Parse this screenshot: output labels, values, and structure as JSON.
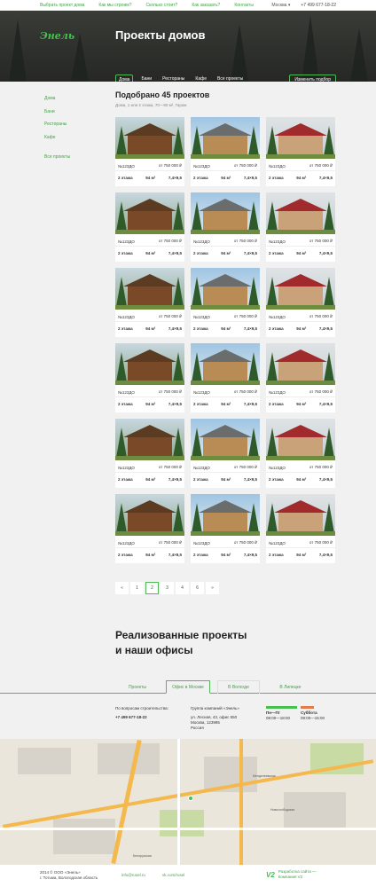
{
  "topbar": {
    "links": [
      "Выбрать проект дома",
      "Как мы строим?",
      "Сколько стоит?",
      "Как заказать?",
      "Контакты"
    ],
    "city": "Москва ▾",
    "phone": "+7 499 677-18-22"
  },
  "hero": {
    "logo": "Энель",
    "title": "Проекты домов",
    "tabs": [
      "Дома",
      "Бани",
      "Рестораны",
      "Кафе",
      "Все проекты"
    ],
    "filter_button": "Изменить подбор"
  },
  "sidebar": {
    "items": [
      "Дома",
      "Бани",
      "Рестораны",
      "Кафе"
    ],
    "all": "Все проекты"
  },
  "results": {
    "heading": "Подобрано 45 проектов",
    "filters": "Дома, 1 или 2 этажа, 70—90 м², Гараж"
  },
  "cards": [
    {
      "id": "№123ДО",
      "price": "от 750 000 ₽",
      "floors": "2 этажа",
      "area": "94 м²",
      "size": "7,4×9,5",
      "style": "wood"
    },
    {
      "id": "№123ДО",
      "price": "от 750 000 ₽",
      "floors": "2 этажа",
      "area": "94 м²",
      "size": "7,4×9,5",
      "style": "log"
    },
    {
      "id": "№123ДО",
      "price": "от 750 000 ₽",
      "floors": "2 этажа",
      "area": "94 м²",
      "size": "7,4×9,5",
      "style": "red"
    },
    {
      "id": "№123ДО",
      "price": "от 750 000 ₽",
      "floors": "2 этажа",
      "area": "94 м²",
      "size": "7,4×9,5",
      "style": "wood"
    },
    {
      "id": "№123ДО",
      "price": "от 750 000 ₽",
      "floors": "2 этажа",
      "area": "94 м²",
      "size": "7,4×9,5",
      "style": "log"
    },
    {
      "id": "№123ДО",
      "price": "от 750 000 ₽",
      "floors": "2 этажа",
      "area": "94 м²",
      "size": "7,4×9,5",
      "style": "red"
    },
    {
      "id": "№123ДО",
      "price": "от 750 000 ₽",
      "floors": "2 этажа",
      "area": "94 м²",
      "size": "7,4×9,5",
      "style": "wood"
    },
    {
      "id": "№123ДО",
      "price": "от 750 000 ₽",
      "floors": "2 этажа",
      "area": "94 м²",
      "size": "7,4×9,5",
      "style": "log"
    },
    {
      "id": "№123ДО",
      "price": "от 750 000 ₽",
      "floors": "2 этажа",
      "area": "94 м²",
      "size": "7,4×9,5",
      "style": "red"
    },
    {
      "id": "№123ДО",
      "price": "от 750 000 ₽",
      "floors": "2 этажа",
      "area": "94 м²",
      "size": "7,4×9,5",
      "style": "wood"
    },
    {
      "id": "№123ДО",
      "price": "от 750 000 ₽",
      "floors": "2 этажа",
      "area": "94 м²",
      "size": "7,4×9,5",
      "style": "log"
    },
    {
      "id": "№123ДО",
      "price": "от 750 000 ₽",
      "floors": "2 этажа",
      "area": "94 м²",
      "size": "7,4×9,5",
      "style": "red"
    },
    {
      "id": "№123ДО",
      "price": "от 750 000 ₽",
      "floors": "2 этажа",
      "area": "94 м²",
      "size": "7,4×9,5",
      "style": "wood"
    },
    {
      "id": "№123ДО",
      "price": "от 750 000 ₽",
      "floors": "2 этажа",
      "area": "94 м²",
      "size": "7,4×9,5",
      "style": "log"
    },
    {
      "id": "№123ДО",
      "price": "от 750 000 ₽",
      "floors": "2 этажа",
      "area": "94 м²",
      "size": "7,4×9,5",
      "style": "red"
    },
    {
      "id": "№123ДО",
      "price": "от 750 000 ₽",
      "floors": "2 этажа",
      "area": "94 м²",
      "size": "7,4×9,5",
      "style": "wood"
    },
    {
      "id": "№123ДО",
      "price": "от 750 000 ₽",
      "floors": "2 этажа",
      "area": "94 м²",
      "size": "7,4×9,5",
      "style": "log"
    },
    {
      "id": "№123ДО",
      "price": "от 750 000 ₽",
      "floors": "2 этажа",
      "area": "94 м²",
      "size": "7,4×9,5",
      "style": "red"
    }
  ],
  "pagination": {
    "prev": "«",
    "pages": [
      "1",
      "2",
      "3",
      "4",
      "6"
    ],
    "current": "2",
    "next": "»"
  },
  "realized": {
    "line1": "Реализованные проекты",
    "line2": "и наши офисы"
  },
  "office_tabs": {
    "projects": "Проекты",
    "moscow": "Офис в Москве",
    "vologda": "В Вологде",
    "lipetsk": "В Липецке"
  },
  "office": {
    "question": "По вопросам строительства:",
    "phone": "+7 499 677-18-22",
    "group": "Группа компаний «Энель»",
    "address1": "ул. Лесная, 43, офис 550",
    "address2": "Москва, 123995",
    "address3": "Россия",
    "weekdays_label": "Пн—Пт",
    "weekdays_hours": "08:00—18:00",
    "saturday_label": "Суббота",
    "saturday_hours": "09:00—15:00"
  },
  "map": {
    "labels": [
      "Менделеевская",
      "Новослободская",
      "Белорусская"
    ]
  },
  "footer": {
    "copyright": "2014 © ООО «Энель»",
    "address": "г. Тотьма, Вологодская область",
    "email": "info@rusel.ru",
    "vk": "vk.com/rusel",
    "dev_logo": "V2",
    "dev1": "Разработка сайта —",
    "dev2": "Компания V2"
  },
  "colors": {
    "accent": "#47c04f",
    "link": "#3da645",
    "hero_bg": "#2e302c",
    "page_bg": "#f1f1f1"
  }
}
